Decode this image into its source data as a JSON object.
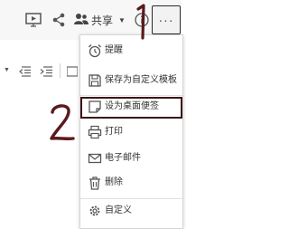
{
  "topbar": {
    "share_label": "共享",
    "more_label": "···"
  },
  "menu": {
    "items": [
      {
        "label": "提醒",
        "icon": "alarm-clock-icon"
      },
      {
        "label": "保存为自定义模板",
        "icon": "save-template-icon"
      },
      {
        "label": "设为桌面便签",
        "icon": "desktop-note-icon"
      },
      {
        "label": "打印",
        "icon": "printer-icon"
      },
      {
        "label": "电子邮件",
        "icon": "envelope-icon"
      },
      {
        "label": "删除",
        "icon": "trash-icon"
      },
      {
        "label": "自定义",
        "icon": "gear-icon"
      }
    ]
  },
  "annotations": {
    "step1": "1",
    "step2": "2"
  },
  "colors": {
    "annotation": "#5a1a1c",
    "icon": "#555555",
    "highlight_border": "#3a1518"
  }
}
